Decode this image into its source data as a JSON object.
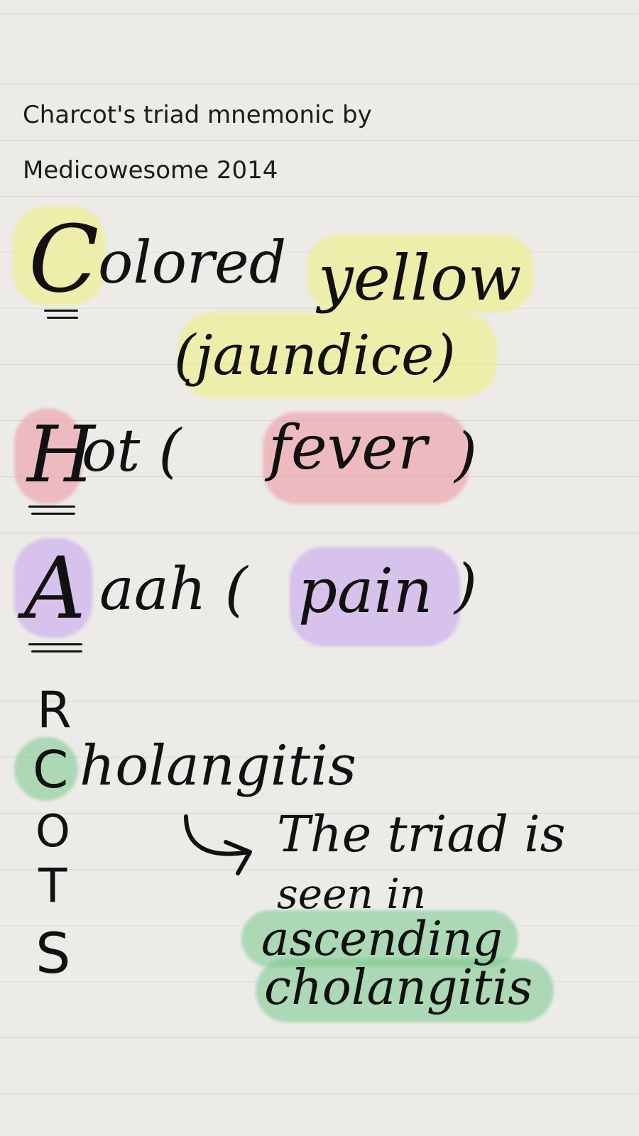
{
  "header": {
    "line1": "Charcot's triad mnemonic by",
    "line2": "Medicowesome 2014"
  },
  "mnemonic": {
    "c_letter": "C",
    "c_rest": "olored",
    "c_yellow": "yellow",
    "c_paren": "(jaundice)",
    "h_letter": "H",
    "h_rest": "ot (",
    "h_fever": "fever",
    "h_close": ")",
    "a_letter": "A",
    "a_rest": "aah (",
    "a_pain": "pain",
    "a_close": ")",
    "r_letter": "R",
    "c2_letter": "C",
    "c2_rest": "holangitis",
    "o_letter": "O",
    "t_letter": "T",
    "s_letter": "S"
  },
  "note": {
    "line1": "The triad is",
    "line2": "seen in",
    "line3": "ascending",
    "line4": "cholangitis"
  },
  "colors": {
    "yellow_highlight": "#f0f078",
    "red_highlight": "#ee8c96",
    "purple_highlight": "#c4a0eb",
    "green_highlight": "#78c88c",
    "ink": "#111111"
  }
}
